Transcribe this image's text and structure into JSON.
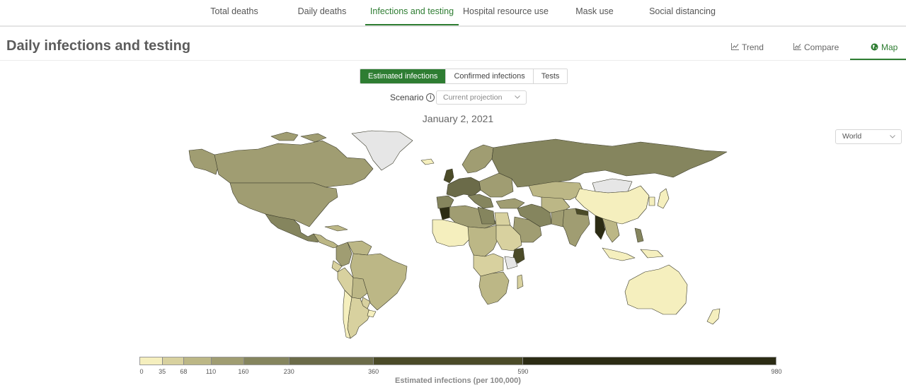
{
  "nav": {
    "tabs": [
      {
        "label": "Total deaths"
      },
      {
        "label": "Daily deaths"
      },
      {
        "label": "Infections and testing",
        "active": true
      },
      {
        "label": "Hospital resource use"
      },
      {
        "label": "Mask use"
      },
      {
        "label": "Social distancing"
      }
    ]
  },
  "header": {
    "title": "Daily infections and testing",
    "view_tabs": [
      {
        "label": "Trend",
        "icon": "line-chart-icon"
      },
      {
        "label": "Compare",
        "icon": "compare-chart-icon"
      },
      {
        "label": "Map",
        "icon": "globe-icon",
        "active": true
      }
    ]
  },
  "metric_tabs": [
    {
      "label": "Estimated infections",
      "active": true
    },
    {
      "label": "Confirmed infections"
    },
    {
      "label": "Tests"
    }
  ],
  "scenario": {
    "label": "Scenario",
    "value": "Current projection"
  },
  "date": "January 2, 2021",
  "region_select": {
    "value": "World"
  },
  "legend": {
    "title": "Estimated infections (per 100,000)",
    "ticks": [
      "0",
      "35",
      "68",
      "110",
      "160",
      "230",
      "360",
      "590",
      "980"
    ],
    "colors": [
      "#f5efbe",
      "#d8d19f",
      "#bcb786",
      "#a09d72",
      "#85855e",
      "#6b6b49",
      "#4b4b28",
      "#2c2c14",
      "#1a1a0a"
    ]
  },
  "colors": {
    "accent": "#2e7d32",
    "no_data": "#e6e6e6",
    "border": "#3a3a2a"
  }
}
